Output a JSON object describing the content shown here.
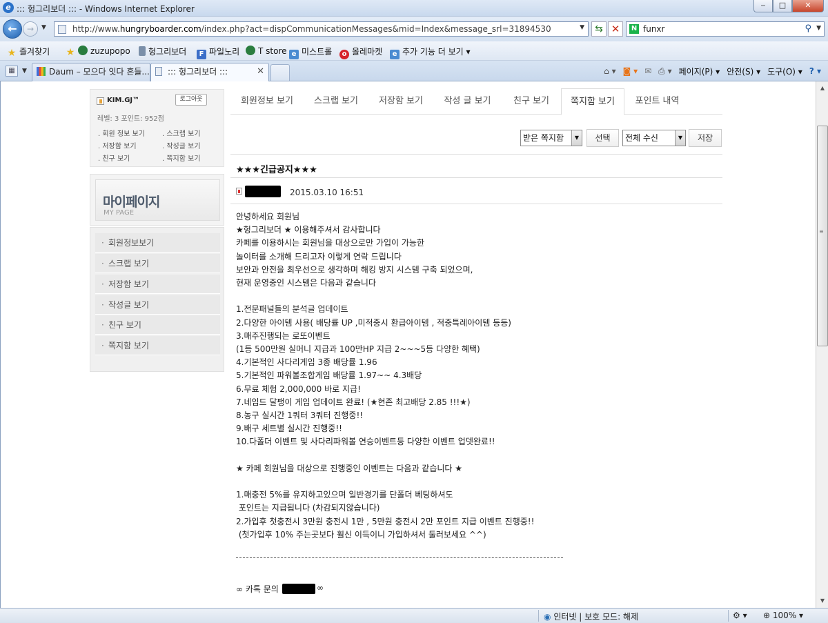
{
  "window": {
    "title": "::: 헝그리보더 ::: - Windows Internet Explorer",
    "min": "‒",
    "max": "□",
    "close": "✕"
  },
  "address": {
    "url_prefix": "http://www.",
    "url_host": "hungryboarder.com",
    "url_path": "/index.php?act=dispCommunicationMessages&mid=Index&message_srl=31894530"
  },
  "search": {
    "query": "funxr"
  },
  "favorites": [
    {
      "label": "즐겨찾기",
      "icon": "star-icon",
      "color": "#e8b51c"
    },
    {
      "label": "zuzupopo",
      "icon": "globe-icon",
      "color": "#2a7d3f"
    },
    {
      "label": "헝그리보더",
      "icon": "page-icon",
      "color": "#7a8fa9"
    },
    {
      "label": "파일노리",
      "icon": "f-icon",
      "color": "#3b6ec8"
    },
    {
      "label": "T store",
      "icon": "globe-icon",
      "color": "#2a7d3f"
    },
    {
      "label": "미스트롤",
      "icon": "ie-page-icon",
      "color": "#4a8bd1"
    },
    {
      "label": "올레마켓",
      "icon": "olleh-icon",
      "color": "#d6232b"
    },
    {
      "label": "추가 기능 더 보기",
      "icon": "ie-page-icon",
      "color": "#4a8bd1"
    }
  ],
  "tabs_browser": [
    {
      "label": "Daum – 모으다 잇다 흔들...",
      "active": false
    },
    {
      "label": "::: 헝그리보더 :::",
      "active": true
    }
  ],
  "command_bar": {
    "page": "페이지(P) ▾",
    "safety": "안전(S) ▾",
    "tools": "도구(O) ▾",
    "help": "? ▾"
  },
  "profile": {
    "name": "KIM.GJ™",
    "logout": "로그아웃",
    "level": "레벨: 3  포인트: 952점",
    "links": [
      "회원 정보 보기",
      "스크랩 보기",
      "저장함 보기",
      "작성글 보기",
      "친구 보기",
      "쪽지함 보기"
    ]
  },
  "mypage": {
    "title": "마이페이지",
    "subtitle": "MY PAGE"
  },
  "sidenav": [
    "회원정보보기",
    "스크랩 보기",
    "저장함 보기",
    "작성글 보기",
    "친구 보기",
    "쪽지함 보기"
  ],
  "page_tabs": [
    {
      "label": "회원정보 보기",
      "active": false
    },
    {
      "label": "스크랩 보기",
      "active": false
    },
    {
      "label": "저장함 보기",
      "active": false
    },
    {
      "label": "작성 글 보기",
      "active": false
    },
    {
      "label": "친구 보기",
      "active": false
    },
    {
      "label": "쪽지함 보기",
      "active": true
    },
    {
      "label": "포인트 내역",
      "active": false
    }
  ],
  "controls": {
    "box_select": "받은 쪽지함",
    "select_button": "선택",
    "filter_select": "전체 수신",
    "save_button": "저장"
  },
  "message": {
    "subject": "★★★긴급공지★★★",
    "date": "2015.03.10 16:51",
    "lines": [
      "안녕하세요 회원님",
      "★헝그리보더 ★ 이용해주셔서 감사합니다",
      "카페를 이용하시는 회원님을 대상으로만 가입이 가능한",
      "놀이터를 소개해 드리고자 이렇게 연락 드립니다",
      "보안과 안전을 최우선으로 생각하며 해킹 방지 시스템 구축 되었으며,",
      "현재 운영중인 시스템은 다음과 같습니다",
      "",
      "1.전문패널들의 분석글 업데이트",
      "2.다양한 아이템 사용( 배당률 UP ,미적중시 환급아이템 , 적중특례아이템 등등)",
      "3.매주진행되는 로또이벤트",
      "(1등 500만원 실머니 지급과 100만HP 지급 2~~~5등 다양한 혜택)",
      "4.기본적인 사다리게임 3종 배당률 1.96",
      "5.기본적인 파워볼조합게임 배당률 1.97~~ 4.3배당",
      "6.무료 체험 2,000,000 바로 지급!",
      "7.네임드 달팽이 게임 업데이트 완료! (★현존 최고배당 2.85 !!!★)",
      "8.농구 실시간 1쿼터 3쿼터 진행중!!",
      "9.배구 세트별 실시간 진행중!!",
      "10.다폴더 이벤트 및 사다리파워볼 연승이벤트등 다양한 이벤트 업뎃완료!!",
      "",
      "★ 카페 회원님을 대상으로 진행중인 이벤트는 다음과 같습니다 ★",
      "",
      "1.매충전 5%를 유지하고있으며 일반경기를 단폴더 베팅하셔도",
      " 포인트는 지급됩니다 (차감되지않습니다)",
      "2.가입후 첫충전시 3만원 충전시 1만 , 5만원 충전시 2만 포인트 지급 이벤트 진행중!!",
      " (첫가입후 10% 주는곳보다 훨신 이득이니 가입하셔서 둘러보세요 ^^)"
    ],
    "dashes": "",
    "kakao_label": "카톡 문의"
  },
  "status": {
    "zone": "인터넷 | 보호 모드: 해제",
    "zoom": "100%"
  }
}
